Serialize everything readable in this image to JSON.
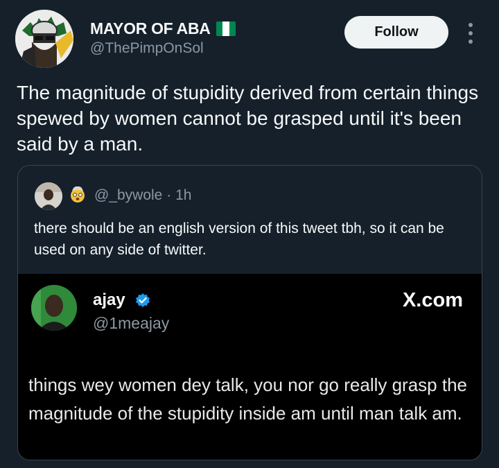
{
  "tweet": {
    "author": {
      "display_name": "MAYOR OF ABA",
      "flag_icon": "nigeria-flag-emoji",
      "handle": "@ThePimpOnSol"
    },
    "follow_label": "Follow",
    "text": "The magnitude of stupidity derived from certain things spewed by women cannot be grasped until it's been said by a man."
  },
  "quote": {
    "emoji_icon": "exploding-head-emoji",
    "handle": "@_bywole",
    "separator": "·",
    "time": "1h",
    "text": "there should be an english version of this tweet tbh, so it can be used on any side of twitter.",
    "media": {
      "name": "ajay",
      "verified_icon": "verified-badge-icon",
      "handle": "@1meajay",
      "brand": "X.com",
      "text": "things wey women dey talk, you nor go really grasp the magnitude of the stupidity inside am until man talk am."
    }
  },
  "colors": {
    "background": "#15202b",
    "text_primary": "#f7f9f9",
    "text_secondary": "#8b98a5",
    "border": "#38444d",
    "follow_bg": "#eff3f4",
    "verified": "#1d9bf0",
    "flag_green": "#008751"
  }
}
